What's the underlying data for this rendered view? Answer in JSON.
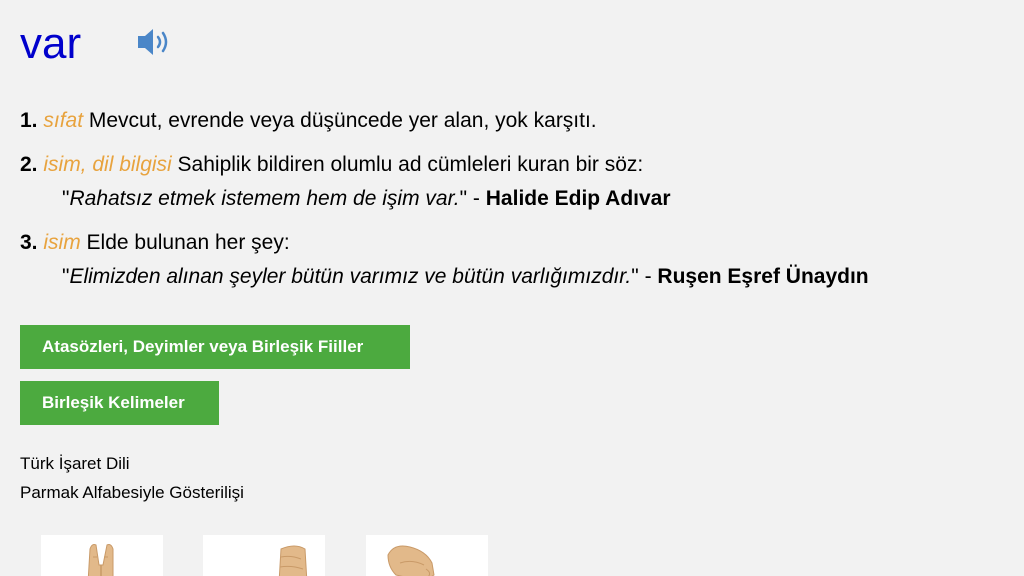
{
  "entry": {
    "headword": "var",
    "speaker_icon": "speaker-icon"
  },
  "senses": [
    {
      "number": "1.",
      "pos": "sıfat",
      "definition": " Mevcut, evrende veya düşüncede yer alan, yok karşıtı."
    },
    {
      "number": "2.",
      "pos": "isim, dil bilgisi",
      "definition": " Sahiplik bildiren olumlu ad cümleleri kuran bir söz:",
      "example": {
        "open": "\"",
        "quote": "Rahatsız etmek istemem hem de işim var.",
        "close": "\" - ",
        "author": "Halide Edip Adıvar"
      }
    },
    {
      "number": "3.",
      "pos": "isim",
      "definition": " Elde bulunan her şey:",
      "example": {
        "open": "\"",
        "quote": "Elimizden alınan şeyler bütün varımız ve bütün varlığımızdır.",
        "close": "\" - ",
        "author": "Ruşen Eşref Ünaydın"
      }
    }
  ],
  "buttons": {
    "idioms": "Atasözleri, Deyimler veya Birleşik Fiiller",
    "compounds": "Birleşik Kelimeler"
  },
  "sign_language": {
    "title": "Türk İşaret Dili",
    "subtitle": "Parmak Alfabesiyle Gösterilişi"
  },
  "colors": {
    "headword": "#0000cc",
    "pos": "#e8a33e",
    "button": "#4caa3f",
    "background": "#f2f2f2",
    "speaker": "#4a86c8",
    "skin": "#e2b98a"
  }
}
